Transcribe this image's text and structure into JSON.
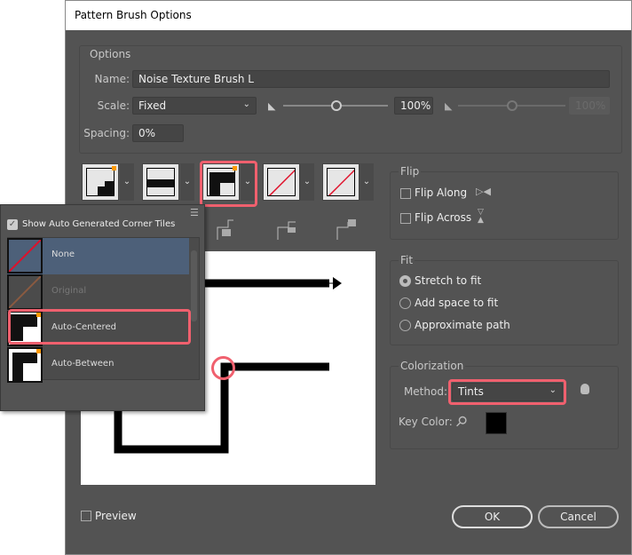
{
  "title": "Pattern Brush Options",
  "options": {
    "group_label": "Options",
    "name_label": "Name:",
    "name_value": "Noise Texture Brush L",
    "scale_label": "Scale:",
    "scale_value": "Fixed",
    "scale_pct": "100%",
    "scale_pct2": "100%",
    "spacing_label": "Spacing:",
    "spacing_value": "0%"
  },
  "flip": {
    "label": "Flip",
    "along": "Flip Along",
    "across": "Flip Across",
    "along_checked": false,
    "across_checked": false
  },
  "fit": {
    "label": "Fit",
    "options": [
      "Stretch to fit",
      "Add space to fit",
      "Approximate path"
    ],
    "selected": "Stretch to fit"
  },
  "colorization": {
    "label": "Colorization",
    "method_label": "Method:",
    "method_value": "Tints",
    "key_color_label": "Key Color:",
    "key_color": "#000000"
  },
  "preview_label": "Preview",
  "preview_checked": false,
  "ok": "OK",
  "cancel": "Cancel",
  "popup": {
    "show_label": "Show Auto Generated Corner Tiles",
    "show_checked": true,
    "items": [
      "None",
      "Original",
      "Auto-Centered",
      "Auto-Between"
    ],
    "selected": "None",
    "highlighted": "Auto-Centered"
  },
  "highlight_color": "#f0606e"
}
